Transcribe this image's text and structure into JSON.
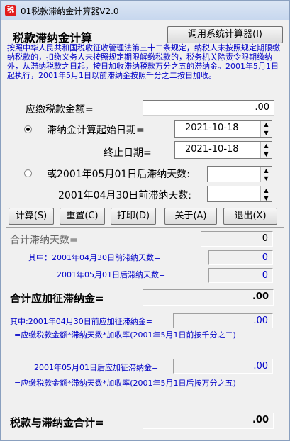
{
  "window": {
    "title": "01税款滞纳金计算器V2.0",
    "icon": "calculator-app-icon"
  },
  "header": {
    "title": "税款滞纳金计算",
    "system_calc_button": "调用系统计算器(I)"
  },
  "description": "按照中华人民共和国税收征收管理法第三十二条规定，纳税人未按照规定期限缴纳税款的，扣缴义务人未按照规定期限解缴税款的，税务机关除责令限期缴纳外，从滞纳税款之日起，按日加收滞纳税款万分之五的滞纳金。2001年5月1日起执行，2001年5月1日以前滞纳金按照千分之二按日加收。",
  "form": {
    "tax_amount_label": "应缴税款金额=",
    "tax_amount_value": ".00",
    "option1": {
      "start_label": "滞纳金计算起始日期=",
      "start_value": "2021-10-18",
      "end_label": "终止日期=",
      "end_value": "2021-10-18",
      "selected": true
    },
    "option2": {
      "after_label": "或2001年05月01日后滞纳天数:",
      "before_label": "2001年04月30日前滞纳天数:",
      "selected": false
    }
  },
  "toolbar": {
    "calc": "计算(S)",
    "reset": "重置(C)",
    "print": "打印(D)",
    "about": "关于(A)",
    "exit": "退出(X)"
  },
  "results": {
    "total_days_label": "合计滞纳天数=",
    "total_days_value": "0",
    "days_before_label": "其中：2001年04月30日前滞纳天数=",
    "days_before_value": "0",
    "days_after_label": "2001年05月01日后滞纳天数=",
    "days_after_value": "0",
    "total_fee_label": "合计应加征滞纳金=",
    "total_fee_value": ".00",
    "fee_before_label": "其中:2001年04月30日前应加征滞纳金=",
    "fee_before_value": ".00",
    "fee_before_formula": "=应缴税款金额*滞纳天数*加收率(2001年5月1日前按千分之二)",
    "fee_after_label": "2001年05月01日后应加征滞纳金=",
    "fee_after_value": ".00",
    "fee_after_formula": "=应缴税款金额*滞纳天数*加收率(2001年5月1日后按万分之五)",
    "grand_total_label": "税款与滞纳金合计=",
    "grand_total_value": ".00"
  }
}
